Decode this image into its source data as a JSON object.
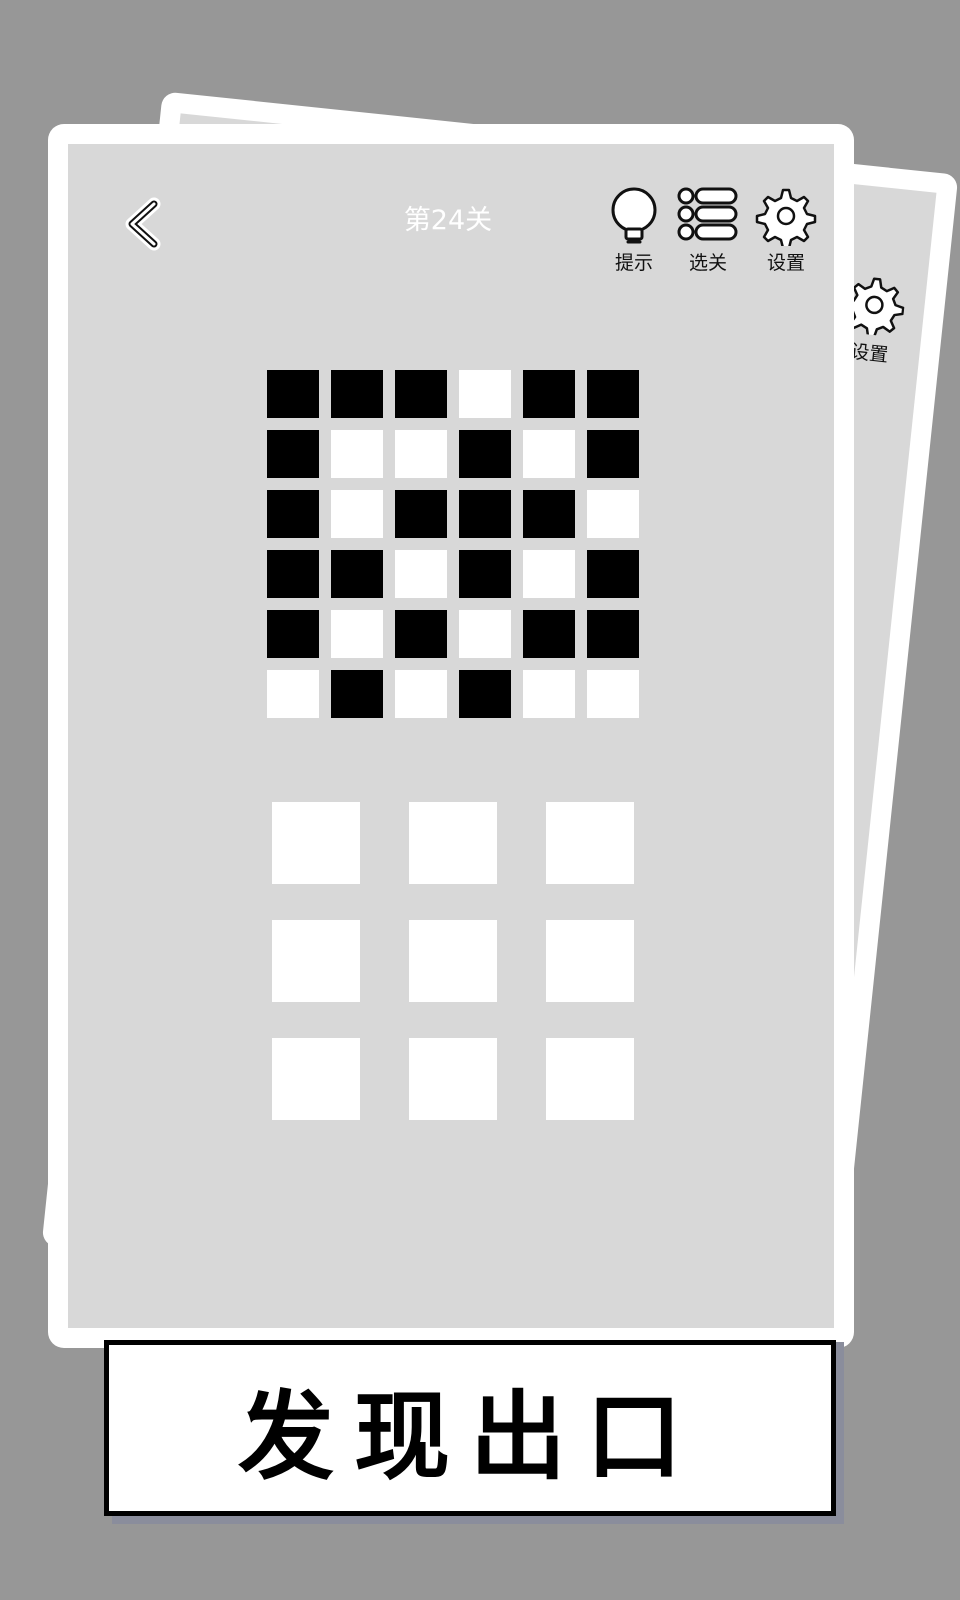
{
  "level_title": "第24关",
  "toolbar": {
    "hint_label": "提示",
    "levels_label": "选关",
    "settings_label": "设置"
  },
  "back_card": {
    "settings_label": "设置"
  },
  "icons": {
    "back": "chevron-left-icon",
    "hint": "lightbulb-icon",
    "levels": "list-icon",
    "settings": "gear-icon"
  },
  "colors": {
    "background": "#979797",
    "card": "#ffffff",
    "card_inner": "#d8d8d8",
    "black_cell": "#000000",
    "white_cell": "#ffffff"
  },
  "pattern_grid": [
    [
      1,
      1,
      1,
      0,
      1,
      1
    ],
    [
      1,
      0,
      0,
      1,
      0,
      1
    ],
    [
      1,
      0,
      1,
      1,
      1,
      0
    ],
    [
      1,
      1,
      0,
      1,
      0,
      1
    ],
    [
      1,
      0,
      1,
      0,
      1,
      1
    ],
    [
      0,
      1,
      0,
      1,
      0,
      0
    ]
  ],
  "tile_grid": {
    "rows": 3,
    "cols": 3
  },
  "banner_text": "发现出口"
}
